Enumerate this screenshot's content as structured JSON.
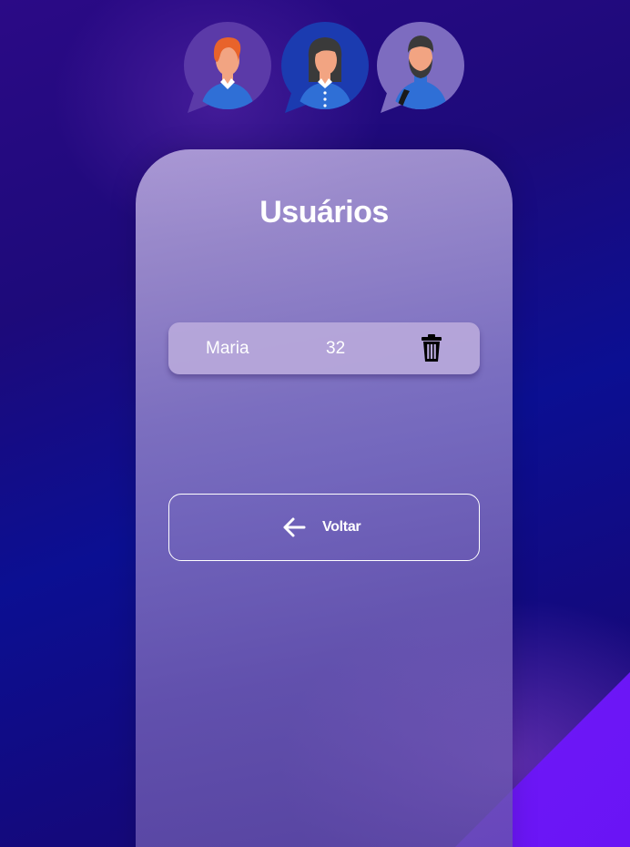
{
  "header": {
    "avatars": [
      {
        "icon": "avatar-redhead-man-icon"
      },
      {
        "icon": "avatar-woman-icon"
      },
      {
        "icon": "avatar-bearded-man-icon"
      }
    ]
  },
  "card": {
    "title": "Usuários",
    "users": [
      {
        "name": "Maria",
        "age": "32",
        "delete_icon": "trash-icon"
      }
    ],
    "back_button": {
      "label": "Voltar",
      "icon": "arrow-left-icon"
    }
  },
  "colors": {
    "accent_corner": "#6a14f5",
    "background": "#1d0a7a",
    "text": "#ffffff"
  }
}
